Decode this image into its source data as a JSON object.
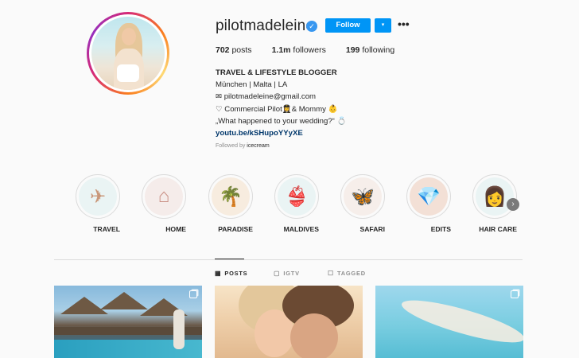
{
  "profile": {
    "username": "pilotmadeleine",
    "follow_label": "Follow",
    "dropdown_icon": "▾",
    "more_icon": "•••",
    "verified_icon": "✓"
  },
  "stats": {
    "posts_value": "702",
    "posts_label": "posts",
    "followers_value": "1.1m",
    "followers_label": "followers",
    "following_value": "199",
    "following_label": "following"
  },
  "bio": {
    "name": "TRAVEL & LIFESTYLE BLOGGER",
    "line1": "München | Malta | LA",
    "line2": "✉ pilotmadeleine@gmail.com",
    "line3": "♡ Commercial Pilot👩‍✈️& Mommy 👶",
    "line4": "„What happened to your wedding?“ 💍",
    "link": "youtu.be/kSHupoYYyXE",
    "followed_by_prefix": "Followed by ",
    "followed_by_user": "icecream"
  },
  "highlights": [
    {
      "label": "TRAVEL",
      "icon": "✈",
      "bg": "#eaf4f4",
      "color": "#c9977a"
    },
    {
      "label": "HOME",
      "icon": "⌂",
      "bg": "#f5ecea",
      "color": "#c98f84"
    },
    {
      "label": "PARADISE",
      "icon": "🌴",
      "bg": "#f7ecdf",
      "color": "#7a5c3c"
    },
    {
      "label": "MALDIVES",
      "icon": "👙",
      "bg": "#eaf4f4",
      "color": "#c9977a"
    },
    {
      "label": "SAFARI",
      "icon": "🦋",
      "bg": "#f6eeea",
      "color": "#b88a70"
    },
    {
      "label": "EDITS",
      "icon": "💎",
      "bg": "#f3e0d6",
      "color": "#c98f84"
    },
    {
      "label": "HAIR CARE",
      "icon": "👩",
      "bg": "#eaf4f4",
      "color": "#c9977a"
    }
  ],
  "highlights_next_icon": "›",
  "tabs": [
    {
      "label": "POSTS",
      "icon": "▦"
    },
    {
      "label": "IGTV",
      "icon": "▢"
    },
    {
      "label": "TAGGED",
      "icon": "☐"
    }
  ]
}
